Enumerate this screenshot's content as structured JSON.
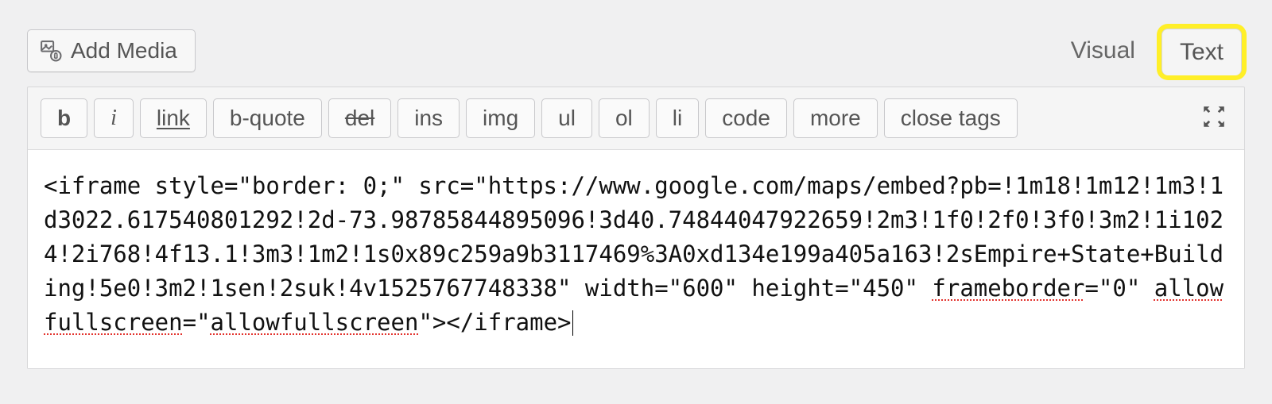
{
  "header": {
    "add_media_label": "Add Media"
  },
  "tabs": {
    "visual": "Visual",
    "text": "Text",
    "active": "text"
  },
  "toolbar": {
    "b": "b",
    "i": "i",
    "link": "link",
    "bquote": "b-quote",
    "del": "del",
    "ins": "ins",
    "img": "img",
    "ul": "ul",
    "ol": "ol",
    "li": "li",
    "code": "code",
    "more": "more",
    "close_tags": "close tags"
  },
  "editor": {
    "seg1": "<iframe style=\"border: 0;\" src=\"https://www.google.com/maps/embed?pb=!1m18!1m12!1m3!1d3022.617540801292!2d-73.98785844895096!3d40.74844047922659!2m3!1f0!2f0!3f0!3m2!1i1024!2i768!4f13.1!3m3!1m2!1s0x89c259a9b3117469%3A0xd134e199a405a163!2sEmpire+State+Building!5e0!3m2!1sen!2suk!4v1525767748338\" width=\"600\" height=\"450\" ",
    "err1": "frameborder",
    "seg2": "=\"0\" ",
    "err2": "allowfullscreen",
    "seg3": "=\"",
    "err3": "allowfullscreen",
    "seg4": "\"></iframe>"
  }
}
